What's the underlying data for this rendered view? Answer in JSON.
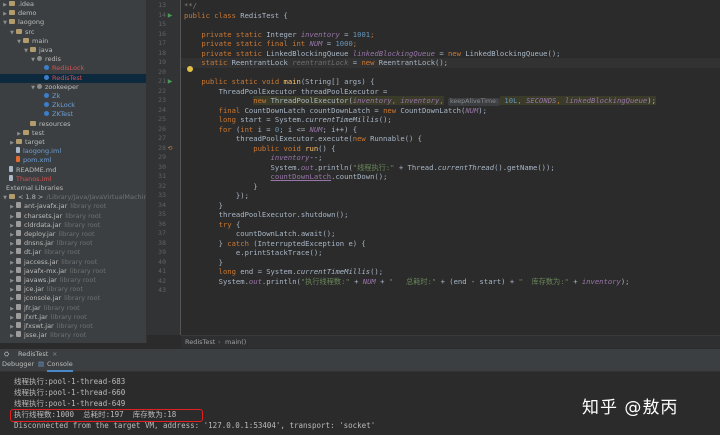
{
  "project_tree": [
    {
      "label": ".idea",
      "depth": 0,
      "arrow": "▶",
      "icon": "folder"
    },
    {
      "label": "demo",
      "depth": 0,
      "arrow": "▶",
      "icon": "folder"
    },
    {
      "label": "laogong",
      "depth": 0,
      "arrow": "▼",
      "icon": "folder"
    },
    {
      "label": "src",
      "depth": 1,
      "arrow": "▼",
      "icon": "folder"
    },
    {
      "label": "main",
      "depth": 2,
      "arrow": "▼",
      "icon": "folder"
    },
    {
      "label": "java",
      "depth": 3,
      "arrow": "▼",
      "icon": "folder"
    },
    {
      "label": "redis",
      "depth": 4,
      "arrow": "▼",
      "icon": "pkg"
    },
    {
      "label": "RedisLock",
      "depth": 5,
      "arrow": "",
      "icon": "java",
      "color": "red"
    },
    {
      "label": "RedisTest",
      "depth": 5,
      "arrow": "",
      "icon": "java",
      "color": "red",
      "selected": true
    },
    {
      "label": "zookeeper",
      "depth": 4,
      "arrow": "▼",
      "icon": "pkg"
    },
    {
      "label": "Zk",
      "depth": 5,
      "arrow": "",
      "icon": "java",
      "color": "blue"
    },
    {
      "label": "ZkLock",
      "depth": 5,
      "arrow": "",
      "icon": "java",
      "color": "blue"
    },
    {
      "label": "ZKTest",
      "depth": 5,
      "arrow": "",
      "icon": "java",
      "color": "blue"
    },
    {
      "label": "resources",
      "depth": 3,
      "arrow": "",
      "icon": "folder"
    },
    {
      "label": "test",
      "depth": 2,
      "arrow": "▶",
      "icon": "folder"
    },
    {
      "label": "target",
      "depth": 1,
      "arrow": "▶",
      "icon": "folder"
    },
    {
      "label": "laogong.iml",
      "depth": 1,
      "arrow": "",
      "icon": "file",
      "color": "blue"
    },
    {
      "label": "pom.xml",
      "depth": 1,
      "arrow": "",
      "icon": "xml",
      "color": "blue"
    },
    {
      "label": "README.md",
      "depth": 0,
      "arrow": "",
      "icon": "file"
    },
    {
      "label": "Thanos.iml",
      "depth": 0,
      "arrow": "",
      "icon": "file",
      "color": "red"
    },
    {
      "label": "External Libraries",
      "depth": -1,
      "arrow": "",
      "icon": ""
    },
    {
      "label": "< 1.8 >",
      "depth": 0,
      "arrow": "▼",
      "icon": "folder",
      "suffix": "/Library/Java/JavaVirtualMachines/j"
    },
    {
      "label": "ant-javafx.jar",
      "depth": 1,
      "arrow": "▶",
      "icon": "lib",
      "suffix": "library root"
    },
    {
      "label": "charsets.jar",
      "depth": 1,
      "arrow": "▶",
      "icon": "lib",
      "suffix": "library root"
    },
    {
      "label": "cldrdata.jar",
      "depth": 1,
      "arrow": "▶",
      "icon": "lib",
      "suffix": "library root"
    },
    {
      "label": "deploy.jar",
      "depth": 1,
      "arrow": "▶",
      "icon": "lib",
      "suffix": "library root"
    },
    {
      "label": "dnsns.jar",
      "depth": 1,
      "arrow": "▶",
      "icon": "lib",
      "suffix": "library root"
    },
    {
      "label": "dt.jar",
      "depth": 1,
      "arrow": "▶",
      "icon": "lib",
      "suffix": "library root"
    },
    {
      "label": "jaccess.jar",
      "depth": 1,
      "arrow": "▶",
      "icon": "lib",
      "suffix": "library root"
    },
    {
      "label": "javafx-mx.jar",
      "depth": 1,
      "arrow": "▶",
      "icon": "lib",
      "suffix": "library root"
    },
    {
      "label": "javaws.jar",
      "depth": 1,
      "arrow": "▶",
      "icon": "lib",
      "suffix": "library root"
    },
    {
      "label": "jce.jar",
      "depth": 1,
      "arrow": "▶",
      "icon": "lib",
      "suffix": "library root"
    },
    {
      "label": "jconsole.jar",
      "depth": 1,
      "arrow": "▶",
      "icon": "lib",
      "suffix": "library root"
    },
    {
      "label": "jfr.jar",
      "depth": 1,
      "arrow": "▶",
      "icon": "lib",
      "suffix": "library root"
    },
    {
      "label": "jfxrt.jar",
      "depth": 1,
      "arrow": "▶",
      "icon": "lib",
      "suffix": "library root"
    },
    {
      "label": "jfxswt.jar",
      "depth": 1,
      "arrow": "▶",
      "icon": "lib",
      "suffix": "library root"
    },
    {
      "label": "jsse.jar",
      "depth": 1,
      "arrow": "▶",
      "icon": "lib",
      "suffix": "library root"
    }
  ],
  "editor": {
    "line_numbers": [
      "13",
      "14",
      "15",
      "16",
      "17",
      "18",
      "19",
      "20",
      "21",
      "22",
      "23",
      "24",
      "25",
      "26",
      "27",
      "28",
      "29",
      "30",
      "31",
      "32",
      "33",
      "34",
      "35",
      "36",
      "37",
      "38",
      "39",
      "40",
      "41",
      "42",
      "43"
    ],
    "code_lines": [
      [
        {
          "t": "**/",
          "c": "cm"
        }
      ],
      [
        {
          "t": "public class ",
          "c": "kw"
        },
        {
          "t": "RedisTest {"
        }
      ],
      [],
      [
        {
          "t": "    "
        },
        {
          "t": "private static ",
          "c": "kw"
        },
        {
          "t": "Integer "
        },
        {
          "t": "inventory",
          "c": "fldi"
        },
        {
          "t": " = "
        },
        {
          "t": "1001",
          "c": "num"
        },
        {
          "t": ";",
          "c": "kw"
        }
      ],
      [
        {
          "t": "    "
        },
        {
          "t": "private static final int ",
          "c": "kw"
        },
        {
          "t": "NUM",
          "c": "fldi"
        },
        {
          "t": " = "
        },
        {
          "t": "1000",
          "c": "num"
        },
        {
          "t": ";",
          "c": "kw"
        }
      ],
      [
        {
          "t": "    "
        },
        {
          "t": "private static ",
          "c": "kw"
        },
        {
          "t": "LinkedBlockingQueue "
        },
        {
          "t": "linkedBlockingQueue",
          "c": "fldi"
        },
        {
          "t": " = "
        },
        {
          "t": "new ",
          "c": "kw"
        },
        {
          "t": "LinkedBlockingQueue();"
        }
      ],
      [
        {
          "t": "    "
        },
        {
          "t": "static ",
          "c": "kw"
        },
        {
          "t": "ReentrantLock "
        },
        {
          "t": "reentrantLock",
          "c": "gray itl"
        },
        {
          "t": " = "
        },
        {
          "t": "new ",
          "c": "kw"
        },
        {
          "t": "ReentrantLock();"
        }
      ],
      [],
      [
        {
          "t": "    "
        },
        {
          "t": "public static void ",
          "c": "kw"
        },
        {
          "t": "main",
          "c": "mth"
        },
        {
          "t": "(String[] args) {"
        }
      ],
      [
        {
          "t": "        ThreadPoolExecutor threadPoolExecutor ="
        }
      ],
      [
        {
          "t": "                "
        },
        {
          "t": "new ",
          "c": "kw newbg"
        },
        {
          "t": "ThreadPoolExecutor(",
          "c": "newbg"
        },
        {
          "t": "inventory",
          "c": "fldi newbg"
        },
        {
          "t": ", ",
          "c": "kw newbg"
        },
        {
          "t": "inventory",
          "c": "fldi newbg"
        },
        {
          "t": ",",
          "c": "kw newbg"
        },
        {
          "t": " "
        },
        {
          "t": "keepAliveTime:",
          "c": "hint"
        },
        {
          "t": " 10L",
          "c": "num newbg"
        },
        {
          "t": ", ",
          "c": "kw newbg"
        },
        {
          "t": "SECONDS",
          "c": "fldi newbg"
        },
        {
          "t": ", ",
          "c": "kw newbg"
        },
        {
          "t": "linkedBlockingQueue",
          "c": "fldi newbg"
        },
        {
          "t": ");",
          "c": "newbg"
        }
      ],
      [
        {
          "t": "        final ",
          "c": "kw"
        },
        {
          "t": "CountDownLatch countDownLatch = "
        },
        {
          "t": "new ",
          "c": "kw"
        },
        {
          "t": "CountDownLatch("
        },
        {
          "t": "NUM",
          "c": "fldi"
        },
        {
          "t": ");"
        }
      ],
      [
        {
          "t": "        long ",
          "c": "kw"
        },
        {
          "t": "start = System."
        },
        {
          "t": "currentTimeMillis",
          "c": "itl"
        },
        {
          "t": "();"
        }
      ],
      [
        {
          "t": "        for ",
          "c": "kw"
        },
        {
          "t": "("
        },
        {
          "t": "int ",
          "c": "kw"
        },
        {
          "t": "i = "
        },
        {
          "t": "0",
          "c": "num"
        },
        {
          "t": "; i <= "
        },
        {
          "t": "NUM",
          "c": "fldi"
        },
        {
          "t": "; i++) {"
        }
      ],
      [
        {
          "t": "            threadPoolExecutor.execute("
        },
        {
          "t": "new ",
          "c": "kw"
        },
        {
          "t": "Runnable() {"
        }
      ],
      [
        {
          "t": "                "
        },
        {
          "t": "public void ",
          "c": "kw"
        },
        {
          "t": "run",
          "c": "mth"
        },
        {
          "t": "() {"
        }
      ],
      [
        {
          "t": "                    "
        },
        {
          "t": "inventory",
          "c": "fldi"
        },
        {
          "t": "--;"
        }
      ],
      [
        {
          "t": "                    System."
        },
        {
          "t": "out",
          "c": "fldi"
        },
        {
          "t": ".println("
        },
        {
          "t": "\"线程执行:\"",
          "c": "str"
        },
        {
          "t": " + Thread."
        },
        {
          "t": "currentThread",
          "c": "itl"
        },
        {
          "t": "().getName());"
        }
      ],
      [
        {
          "t": "                    "
        },
        {
          "t": "countDownLatch",
          "c": "fld ul"
        },
        {
          "t": ".countDown();"
        }
      ],
      [
        {
          "t": "                }"
        }
      ],
      [
        {
          "t": "            });"
        }
      ],
      [
        {
          "t": "        }"
        }
      ],
      [
        {
          "t": "        threadPoolExecutor.shutdown();"
        }
      ],
      [
        {
          "t": "        try ",
          "c": "kw"
        },
        {
          "t": "{"
        }
      ],
      [
        {
          "t": "            countDownLatch.await();"
        }
      ],
      [
        {
          "t": "        } "
        },
        {
          "t": "catch ",
          "c": "kw"
        },
        {
          "t": "(InterruptedException e) {"
        }
      ],
      [
        {
          "t": "            e.printStackTrace();"
        }
      ],
      [
        {
          "t": "        }"
        }
      ],
      [
        {
          "t": "        long ",
          "c": "kw"
        },
        {
          "t": "end = System."
        },
        {
          "t": "currentTimeMillis",
          "c": "itl"
        },
        {
          "t": "();"
        }
      ],
      [
        {
          "t": "        System."
        },
        {
          "t": "out",
          "c": "fldi"
        },
        {
          "t": ".println("
        },
        {
          "t": "\"执行线程数:\"",
          "c": "str"
        },
        {
          "t": " + "
        },
        {
          "t": "NUM",
          "c": "fldi"
        },
        {
          "t": " + "
        },
        {
          "t": "\"   总耗时:\"",
          "c": "str"
        },
        {
          "t": " + (end - start) + "
        },
        {
          "t": "\"  库存数为:\"",
          "c": "str"
        },
        {
          "t": " + "
        },
        {
          "t": "inventory",
          "c": "fldi"
        },
        {
          "t": ");"
        }
      ],
      []
    ],
    "highlight_line_index": 6,
    "breadcrumb": [
      "RedisTest",
      "main()"
    ]
  },
  "run_panel": {
    "run_tab": "RedisTest",
    "debugger_tab": "Debugger",
    "console_tab": "Console"
  },
  "console_lines": [
    "线程执行:pool-1-thread-683",
    "线程执行:pool-1-thread-660",
    "线程执行:pool-1-thread-649",
    "执行线程数:1000  总耗时:197  库存数为:18",
    "Disconnected from the target VM, address: '127.0.0.1:53404', transport: 'socket'"
  ],
  "watermark": "知乎 @敖丙"
}
